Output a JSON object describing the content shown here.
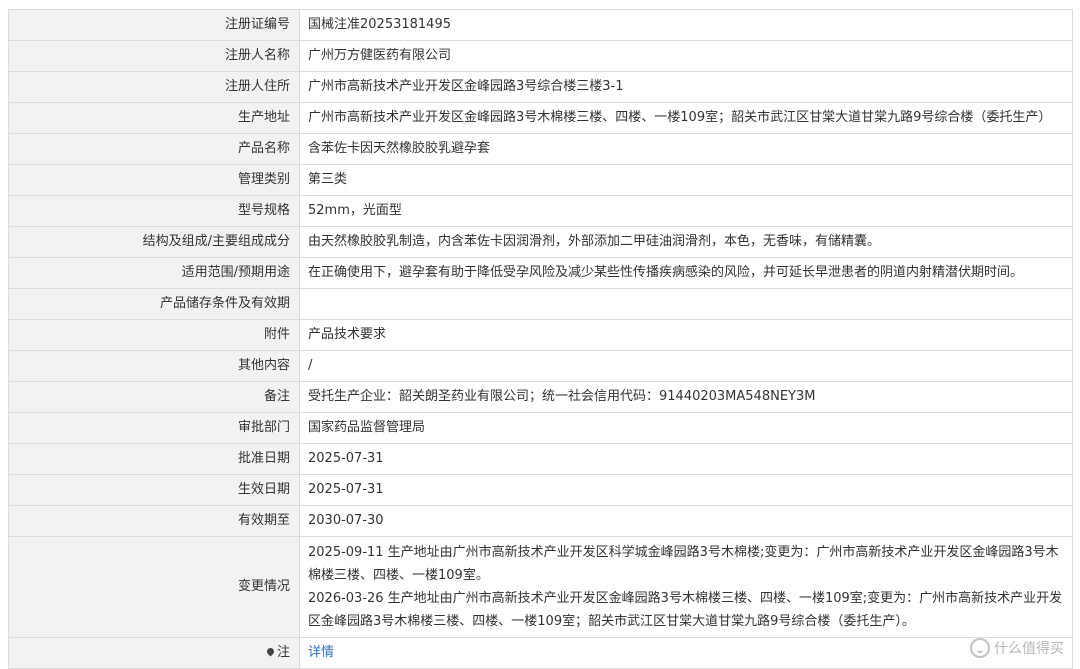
{
  "record": {
    "rows": [
      {
        "label": "注册证编号",
        "value": "国械注准20253181495"
      },
      {
        "label": "注册人名称",
        "value": "广州万方健医药有限公司"
      },
      {
        "label": "注册人住所",
        "value": "广州市高新技术产业开发区金峰园路3号综合楼三楼3-1"
      },
      {
        "label": "生产地址",
        "value": "广州市高新技术产业开发区金峰园路3号木棉楼三楼、四楼、一楼109室；韶关市武江区甘棠大道甘棠九路9号综合楼（委托生产）"
      },
      {
        "label": "产品名称",
        "value": "含苯佐卡因天然橡胶胶乳避孕套"
      },
      {
        "label": "管理类别",
        "value": "第三类"
      },
      {
        "label": "型号规格",
        "value": "52mm，光面型"
      },
      {
        "label": "结构及组成/主要组成成分",
        "value": "由天然橡胶胶乳制造，内含苯佐卡因润滑剂，外部添加二甲硅油润滑剂，本色，无香味，有储精囊。"
      },
      {
        "label": "适用范围/预期用途",
        "value": "在正确使用下，避孕套有助于降低受孕风险及减少某些性传播疾病感染的风险，并可延长早泄患者的阴道内射精潜伏期时间。"
      },
      {
        "label": "产品储存条件及有效期",
        "value": ""
      },
      {
        "label": "附件",
        "value": "产品技术要求"
      },
      {
        "label": "其他内容",
        "value": "/"
      },
      {
        "label": "备注",
        "value": "受托生产企业：韶关朗圣药业有限公司；统一社会信用代码：91440203MA548NEY3M"
      },
      {
        "label": "审批部门",
        "value": "国家药品监督管理局"
      },
      {
        "label": "批准日期",
        "value": "2025-07-31"
      },
      {
        "label": "生效日期",
        "value": "2025-07-31"
      },
      {
        "label": "有效期至",
        "value": "2030-07-30"
      }
    ],
    "changes": {
      "label": "变更情况",
      "entries": [
        "2025-09-11 生产地址由广州市高新技术产业开发区科学城金峰园路3号木棉楼;变更为：广州市高新技术产业开发区金峰园路3号木棉楼三楼、四楼、一楼109室。",
        "2026-03-26 生产地址由广州市高新技术产业开发区金峰园路3号木棉楼三楼、四楼、一楼109室;变更为：广州市高新技术产业开发区金峰园路3号木棉楼三楼、四楼、一楼109室；韶关市武江区甘棠大道甘棠九路9号综合楼（委托生产）。"
      ]
    },
    "note": {
      "label": "注",
      "link_text": "详情",
      "icon": "pin-icon"
    }
  },
  "watermark": {
    "text": "什么值得买",
    "icon": "smzdm-logo-icon"
  },
  "colors": {
    "label_bg": "#f2f2f2",
    "border": "#dcdcdc",
    "link": "#2a6fdb",
    "text": "#333333"
  }
}
